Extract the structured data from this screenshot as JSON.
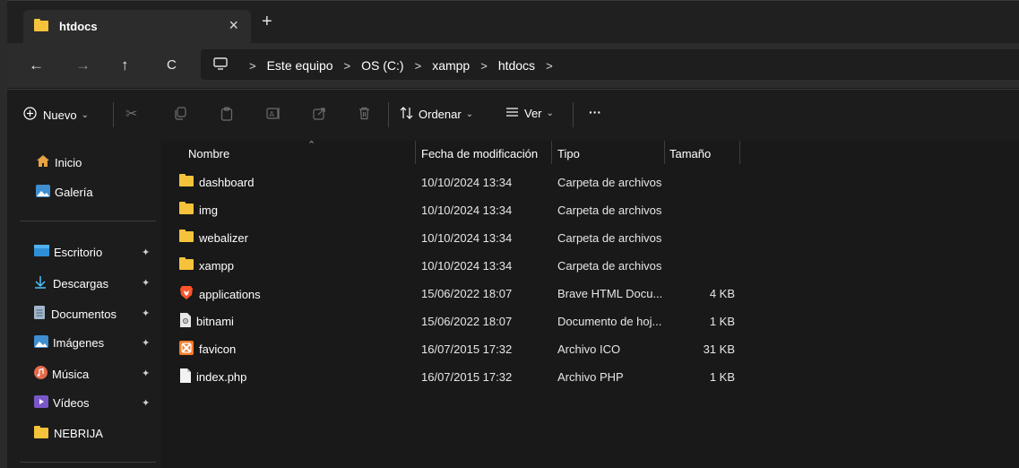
{
  "window": {
    "tab_title": "htdocs",
    "tab_close": "×",
    "new_tab": "+"
  },
  "nav": {
    "back": "←",
    "forward": "→",
    "up": "↑",
    "refresh": "C"
  },
  "breadcrumb": [
    "Este equipo",
    "OS (C:)",
    "xampp",
    "htdocs"
  ],
  "toolbar": {
    "new_label": "Nuevo",
    "sort_label": "Ordenar",
    "view_label": "Ver",
    "more_label": "···"
  },
  "sidebar": {
    "top_items": [
      {
        "label": "Inicio",
        "icon": "home-icon"
      },
      {
        "label": "Galería",
        "icon": "gallery-icon"
      }
    ],
    "pinned_items": [
      {
        "label": "Escritorio",
        "icon": "desktop-icon"
      },
      {
        "label": "Descargas",
        "icon": "download-icon"
      },
      {
        "label": "Documentos",
        "icon": "documents-icon"
      },
      {
        "label": "Imágenes",
        "icon": "pictures-icon"
      },
      {
        "label": "Música",
        "icon": "music-icon"
      },
      {
        "label": "Vídeos",
        "icon": "videos-icon"
      },
      {
        "label": "NEBRIJA",
        "icon": "folder-icon"
      }
    ]
  },
  "columns": {
    "name": "Nombre",
    "modified": "Fecha de modificación",
    "type": "Tipo",
    "size": "Tamaño"
  },
  "files": [
    {
      "name": "dashboard",
      "modified": "10/10/2024 13:34",
      "type": "Carpeta de archivos",
      "size": "",
      "icon": "folder-icon"
    },
    {
      "name": "img",
      "modified": "10/10/2024 13:34",
      "type": "Carpeta de archivos",
      "size": "",
      "icon": "folder-icon"
    },
    {
      "name": "webalizer",
      "modified": "10/10/2024 13:34",
      "type": "Carpeta de archivos",
      "size": "",
      "icon": "folder-icon"
    },
    {
      "name": "xampp",
      "modified": "10/10/2024 13:34",
      "type": "Carpeta de archivos",
      "size": "",
      "icon": "folder-icon"
    },
    {
      "name": "applications",
      "modified": "15/06/2022 18:07",
      "type": "Brave HTML Docu...",
      "size": "4 KB",
      "icon": "brave-html-icon"
    },
    {
      "name": "bitnami",
      "modified": "15/06/2022 18:07",
      "type": "Documento de hoj...",
      "size": "1 KB",
      "icon": "stylesheet-icon"
    },
    {
      "name": "favicon",
      "modified": "16/07/2015 17:32",
      "type": "Archivo ICO",
      "size": "31 KB",
      "icon": "xampp-icon"
    },
    {
      "name": "index.php",
      "modified": "16/07/2015 17:32",
      "type": "Archivo PHP",
      "size": "1 KB",
      "icon": "file-icon"
    }
  ],
  "colors": {
    "folder": "#f5c33b",
    "brave": "#fb542b",
    "xampp": "#fb7a24",
    "accent": "#4cc2ff"
  }
}
